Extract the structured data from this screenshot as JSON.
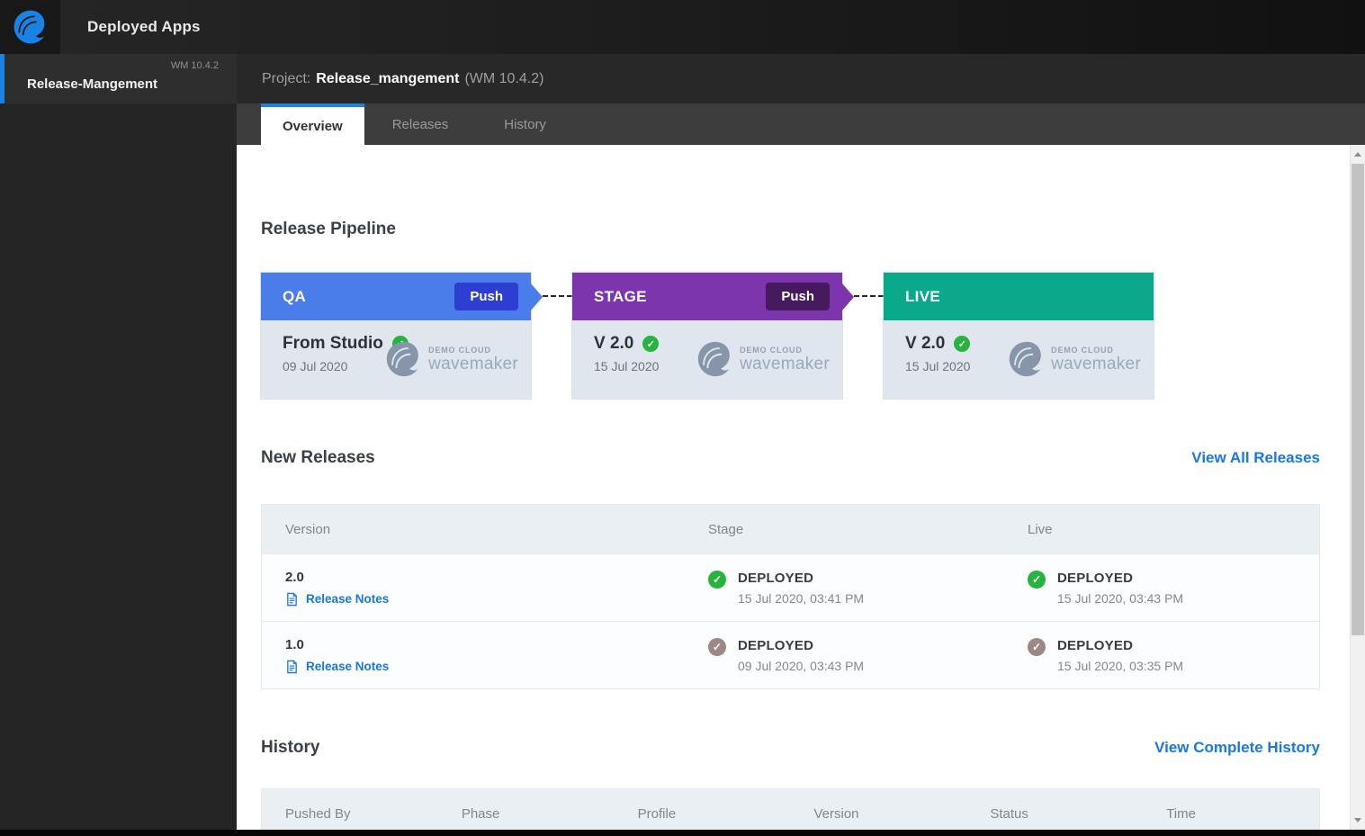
{
  "topbar": {
    "title": "Deployed Apps"
  },
  "sidebar": {
    "app_name": "Release-Mangement",
    "app_version": "WM 10.4.2"
  },
  "project_header": {
    "label": "Project:",
    "name": "Release_mangement",
    "version": "(WM 10.4.2)"
  },
  "tabs": {
    "overview": "Overview",
    "releases": "Releases",
    "history": "History"
  },
  "pipeline": {
    "heading": "Release Pipeline",
    "brand": {
      "line1": "DEMO CLOUD",
      "line2": "wavemaker"
    },
    "stages": [
      {
        "name": "QA",
        "push": "Push",
        "label": "From Studio",
        "date": "09 Jul 2020",
        "header_color": "#4a7de9",
        "push_bg": "#2e3ed2",
        "check_color": "#27b43e"
      },
      {
        "name": "STAGE",
        "push": "Push",
        "label": "V 2.0",
        "date": "15 Jul 2020",
        "header_color": "#7c35ad",
        "push_bg": "#451a5f",
        "check_color": "#27b43e"
      },
      {
        "name": "LIVE",
        "label": "V 2.0",
        "date": "15 Jul 2020",
        "header_color": "#0aa98c",
        "check_color": "#27b43e"
      }
    ]
  },
  "new_releases": {
    "heading": "New Releases",
    "view_all": "View All Releases",
    "columns": [
      "Version",
      "Stage",
      "Live"
    ],
    "rows": [
      {
        "version": "2.0",
        "notes": "Release Notes",
        "stage": {
          "status": "DEPLOYED",
          "time": "15 Jul 2020, 03:41 PM",
          "icon_color": "#27b43e"
        },
        "live": {
          "status": "DEPLOYED",
          "time": "15 Jul 2020, 03:43 PM",
          "icon_color": "#27b43e"
        }
      },
      {
        "version": "1.0",
        "notes": "Release Notes",
        "stage": {
          "status": "DEPLOYED",
          "time": "09 Jul 2020, 03:43 PM",
          "icon_color": "#9d8888"
        },
        "live": {
          "status": "DEPLOYED",
          "time": "15 Jul 2020, 03:35 PM",
          "icon_color": "#9d8888"
        }
      }
    ]
  },
  "history": {
    "heading": "History",
    "view_all": "View Complete History",
    "columns": [
      "Pushed By",
      "Phase",
      "Profile",
      "Version",
      "Status",
      "Time"
    ]
  },
  "colors": {
    "accent_blue": "#1a82e2",
    "link_blue": "#1778e8",
    "green": "#27b43e",
    "taupe": "#9d8888"
  }
}
